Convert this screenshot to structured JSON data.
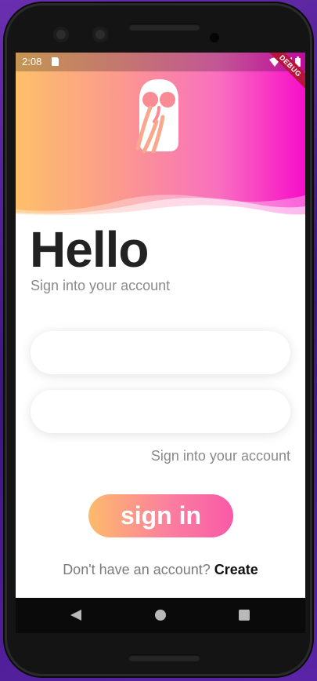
{
  "status_bar": {
    "time": "2:08",
    "debug_label": "DEBUG"
  },
  "header": {
    "gradient_colors": [
      "#fdc06a",
      "#f70ec9"
    ],
    "logo_icon": "owl-icon"
  },
  "login": {
    "title": "Hello",
    "subtitle": "Sign into your account",
    "username_value": "",
    "password_value": "",
    "secondary_link": "Sign into your account",
    "submit_label": "sign in",
    "footer_prompt": "Don't have an account?",
    "footer_link": "Create"
  },
  "nav_bar": {
    "icons": [
      "back-icon",
      "home-icon",
      "recents-icon"
    ]
  }
}
